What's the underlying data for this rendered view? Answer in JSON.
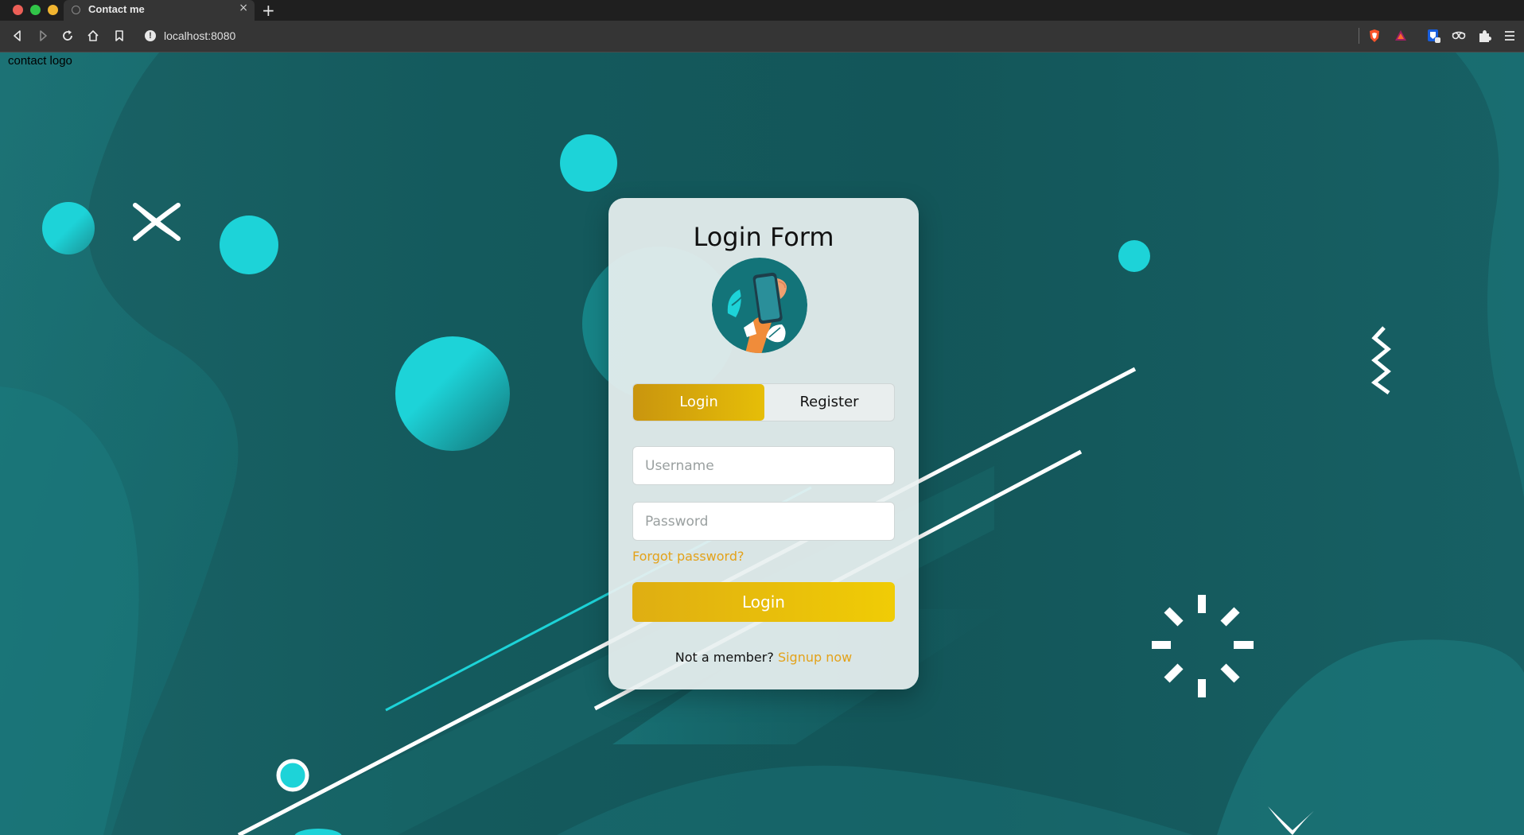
{
  "browser": {
    "tab_title": "Contact me",
    "tab_close": "×",
    "new_tab": "+",
    "url": "localhost:8080",
    "url_info": "!"
  },
  "page": {
    "logo_alt": "contact logo"
  },
  "form": {
    "title": "Login Form",
    "toggle": {
      "login": "Login",
      "register": "Register"
    },
    "username_placeholder": "Username",
    "password_placeholder": "Password",
    "forgot": "Forgot password?",
    "submit": "Login",
    "signup_prompt": "Not a member?",
    "signup_link": "Signup now"
  },
  "colors": {
    "background": "#14575a",
    "accent_cyan": "#1dd3d8",
    "accent_gold": "#e6be08",
    "link_orange": "#e3a21a"
  },
  "icons": [
    "back-icon",
    "forward-icon",
    "reload-icon",
    "home-icon",
    "bookmark-icon",
    "brave-shield-icon",
    "brave-rewards-icon",
    "bitwarden-icon",
    "privacy-icon",
    "extensions-icon",
    "menu-icon"
  ]
}
